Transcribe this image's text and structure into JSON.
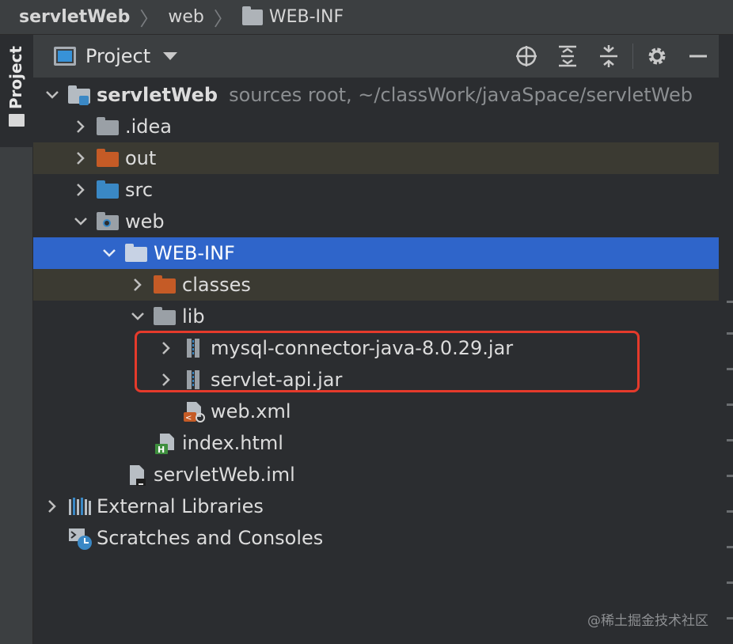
{
  "breadcrumb": {
    "items": [
      "servletWeb",
      "web",
      "WEB-INF"
    ]
  },
  "toolwindow": {
    "stripe_label": "Project"
  },
  "header": {
    "title": "Project",
    "actions": [
      "locate-icon",
      "expand-all-icon",
      "collapse-all-icon",
      "gear-icon",
      "minimize-icon"
    ]
  },
  "tree": {
    "root": {
      "name": "servletWeb",
      "detail": "sources root, ~/classWork/javaSpace/servletWeb"
    },
    "idea": ".idea",
    "out": "out",
    "src": "src",
    "web": "web",
    "webinf": "WEB-INF",
    "classes": "classes",
    "lib": "lib",
    "jar1": "mysql-connector-java-8.0.29.jar",
    "jar2": "servlet-api.jar",
    "webxml": "web.xml",
    "index": "index.html",
    "iml": "servletWeb.iml",
    "external": "External Libraries",
    "scratches": "Scratches and Consoles"
  },
  "colors": {
    "selection": "#2f65ca",
    "excluded_row": "#3b3a32",
    "highlight_box": "#e53a2b"
  },
  "watermark": "@稀土掘金技术社区"
}
